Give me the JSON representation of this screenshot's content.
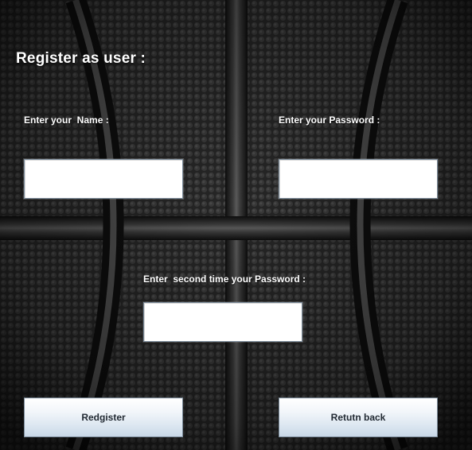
{
  "form": {
    "title": "Register as user :",
    "name_label": "Enter your  Name :",
    "name_value": "",
    "password_label": "Enter your Password :",
    "password_value": "",
    "confirm_label": "Enter  second time your Password :",
    "confirm_value": ""
  },
  "buttons": {
    "register_label": "Redgister",
    "return_label": "Retutn back"
  },
  "colors": {
    "text": "#ffffff",
    "button_gradient_top": "#ffffff",
    "button_gradient_bottom": "#c9d8e7",
    "background": "#1a1a1a"
  }
}
